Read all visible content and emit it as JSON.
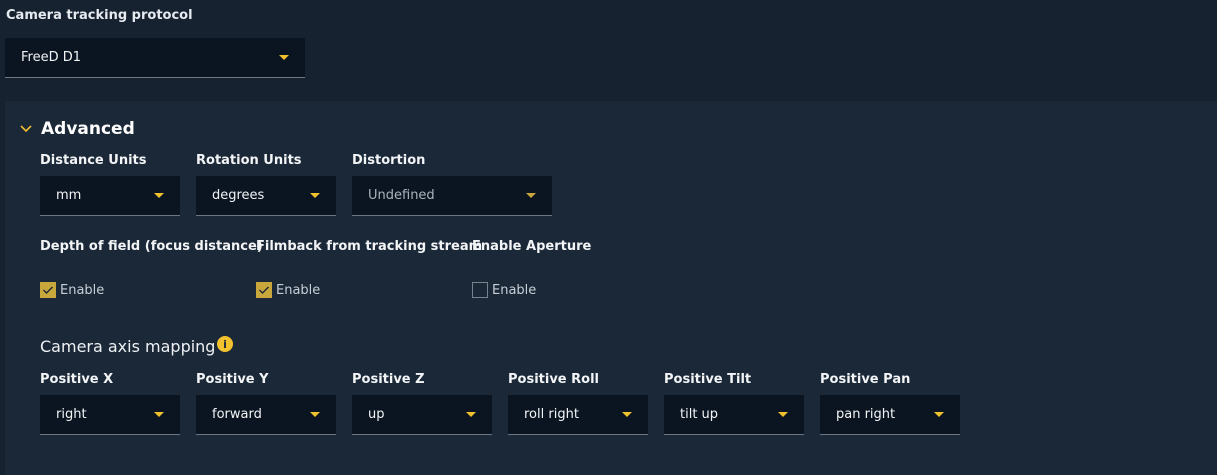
{
  "protocol": {
    "label": "Camera tracking protocol",
    "value": "FreeD D1"
  },
  "advanced": {
    "title": "Advanced",
    "units": [
      {
        "label": "Distance Units",
        "value": "mm"
      },
      {
        "label": "Rotation Units",
        "value": "degrees"
      },
      {
        "label": "Distortion",
        "value": "Undefined"
      }
    ],
    "options": [
      {
        "label": "Depth of field (focus distance)",
        "check_label": "Enable",
        "checked": true
      },
      {
        "label": "Filmback from tracking stream",
        "check_label": "Enable",
        "checked": true
      },
      {
        "label": "Enable Aperture",
        "check_label": "Enable",
        "checked": false
      }
    ],
    "axis_mapping": {
      "title": "Camera axis mapping",
      "info_icon": "i",
      "fields": [
        {
          "label": "Positive X",
          "value": "right"
        },
        {
          "label": "Positive Y",
          "value": "forward"
        },
        {
          "label": "Positive Z",
          "value": "up"
        },
        {
          "label": "Positive Roll",
          "value": "roll right"
        },
        {
          "label": "Positive Tilt",
          "value": "tilt up"
        },
        {
          "label": "Positive Pan",
          "value": "pan right"
        }
      ]
    }
  },
  "colors": {
    "accent": "#f2c12e",
    "background": "#172231",
    "panel": "#1b2838",
    "field": "#0b1521"
  }
}
